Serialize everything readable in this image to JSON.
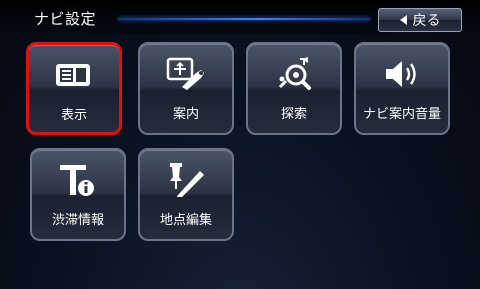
{
  "header": {
    "title": "ナビ設定",
    "back_label": "戻る"
  },
  "tiles": [
    {
      "label": "表示",
      "icon": "display-icon",
      "selected": true
    },
    {
      "label": "案内",
      "icon": "guidance-icon"
    },
    {
      "label": "探索",
      "icon": "search-route-icon"
    },
    {
      "label": "ナビ案内音量",
      "icon": "speaker-icon"
    },
    {
      "label": "渋滞情報",
      "icon": "traffic-info-icon"
    },
    {
      "label": "地点編集",
      "icon": "edit-location-icon"
    }
  ],
  "colors": {
    "accent_line": "#3f82ff",
    "selected_border": "#e01010"
  }
}
